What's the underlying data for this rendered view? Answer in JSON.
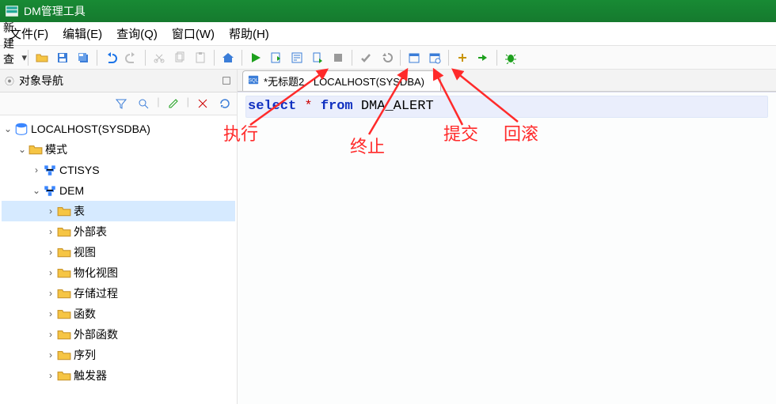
{
  "app": {
    "title": "DM管理工具"
  },
  "menubar": {
    "file": "文件(F)",
    "edit": "编辑(E)",
    "query": "查询(Q)",
    "window": "窗口(W)",
    "help": "帮助(H)"
  },
  "toolbar": {
    "new_query_label": "新建查询(N)"
  },
  "sidebar": {
    "title": "对象导航",
    "tree": {
      "root": "LOCALHOST(SYSDBA)",
      "schema_group": "模式",
      "ctisys": "CTISYS",
      "dem": "DEM",
      "dem_children": [
        "表",
        "外部表",
        "视图",
        "物化视图",
        "存储过程",
        "函数",
        "外部函数",
        "序列",
        "触发器"
      ]
    }
  },
  "editor": {
    "tab_title": "*无标题2 - LOCALHOST(SYSDBA)",
    "sql_kw_select": "select",
    "sql_star": "*",
    "sql_kw_from": "from",
    "sql_ident": "DMA_ALERT"
  },
  "annotations": {
    "execute": "执行",
    "stop": "终止",
    "commit": "提交",
    "rollback": "回滚"
  }
}
